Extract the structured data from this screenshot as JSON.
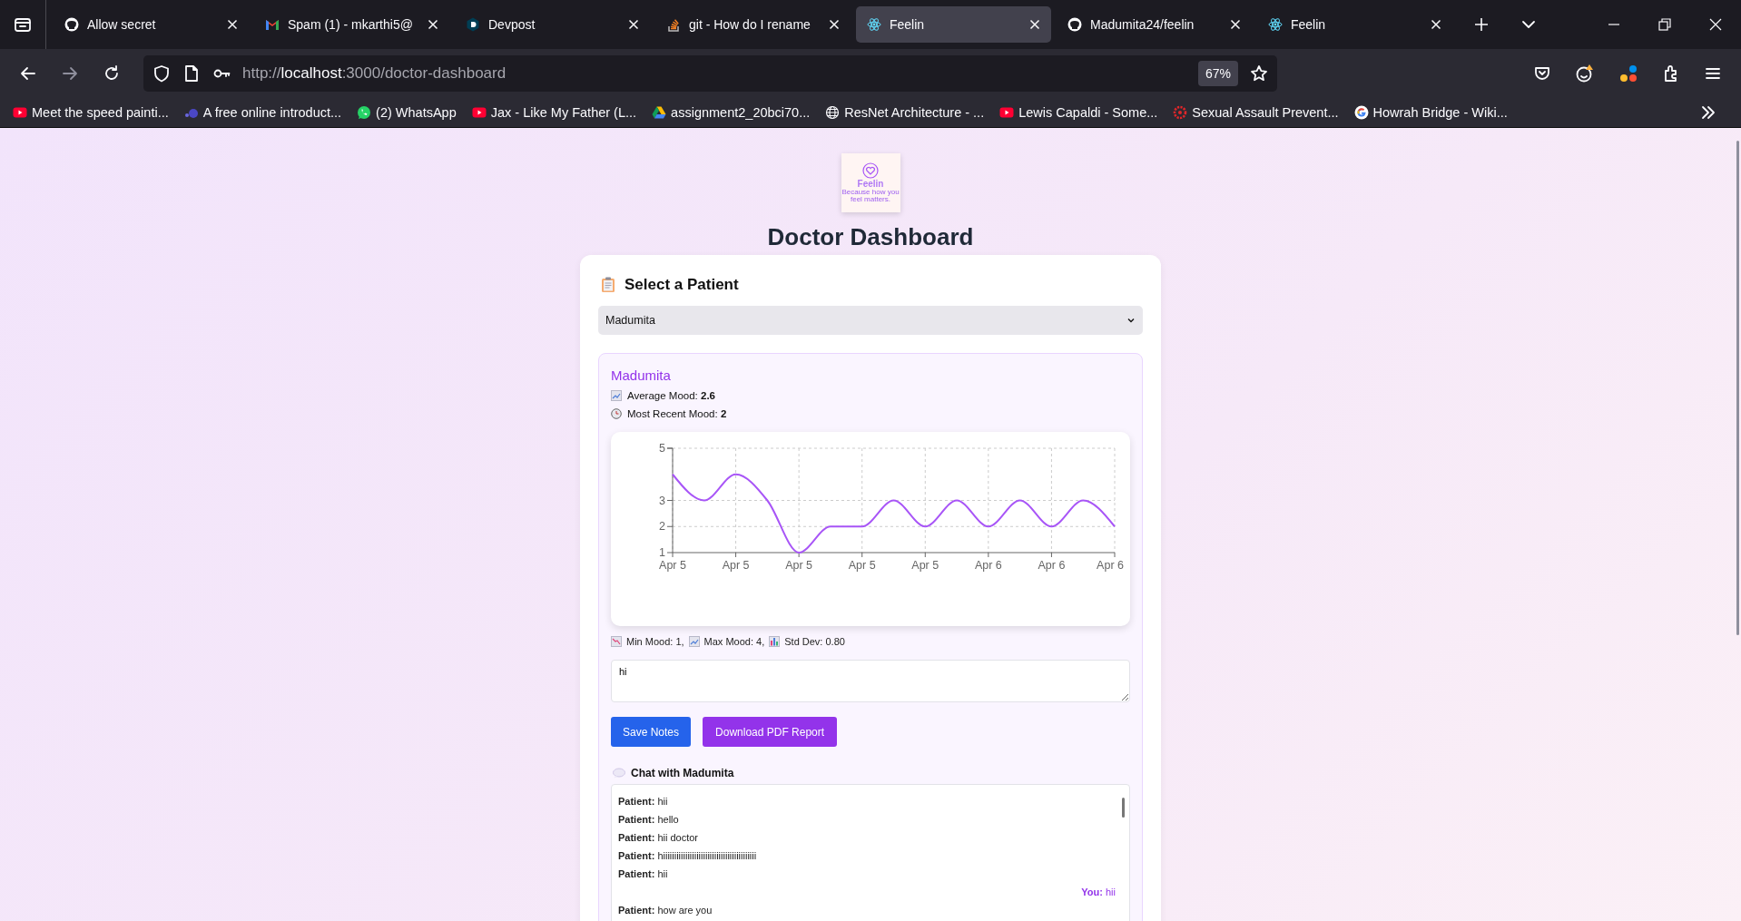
{
  "browser": {
    "tabs": [
      {
        "title": "Allow secret",
        "kind": "octo",
        "selected": false
      },
      {
        "title": "Spam (1) - mkarthi5@",
        "kind": "envelope",
        "selected": false
      },
      {
        "title": "Devpost",
        "kind": "hexagon",
        "selected": false
      },
      {
        "title": "git - How do I rename",
        "kind": "stack",
        "selected": false
      },
      {
        "title": "Feelin",
        "kind": "atom",
        "selected": true
      },
      {
        "title": "Madumita24/feelin",
        "kind": "octo",
        "selected": false
      },
      {
        "title": "Feelin",
        "kind": "atom",
        "selected": false
      }
    ],
    "url": {
      "scheme": "http://",
      "host": "localhost",
      "path": ":3000/doctor-dashboard"
    },
    "zoom": "67%",
    "bookmarks": [
      {
        "title": "Meet the speed painti...",
        "kind": "play"
      },
      {
        "title": "A free online introduct...",
        "kind": "dots"
      },
      {
        "title": "(2) WhatsApp",
        "kind": "bubble"
      },
      {
        "title": "Jax - Like My Father (L...",
        "kind": "play"
      },
      {
        "title": "assignment2_20bci70...",
        "kind": "triangle"
      },
      {
        "title": "ResNet Architecture - ...",
        "kind": "globe"
      },
      {
        "title": "Lewis Capaldi - Some...",
        "kind": "play"
      },
      {
        "title": "Sexual Assault Prevent...",
        "kind": "ring"
      },
      {
        "title": "Howrah Bridge - Wiki...",
        "kind": "multicolor"
      }
    ]
  },
  "page": {
    "logo": {
      "name": "Feelin",
      "tagline": "Because how you feel matters."
    },
    "title": "Doctor Dashboard",
    "select_heading": "Select a Patient",
    "patient_select": {
      "value": "Madumita"
    },
    "patient": {
      "name": "Madumita",
      "stats": [
        {
          "kind": "trend",
          "text": "Average Mood: **2.6**"
        },
        {
          "kind": "clock",
          "text": "Most Recent Mood: **2**"
        }
      ],
      "chart_data": {
        "type": "line",
        "categories": [
          "Apr 5",
          null,
          "Apr 5",
          null,
          "Apr 5",
          null,
          "Apr 5",
          null,
          "Apr 5",
          null,
          "Apr 6",
          null,
          "Apr 6",
          null,
          "Apr 6"
        ],
        "ylim": [
          1,
          5
        ],
        "yticks": [
          1,
          2,
          3,
          5
        ],
        "grid": true,
        "series": [
          {
            "color": "#a855f7",
            "values": [
              4,
              3,
              4,
              3,
              1,
              2,
              2,
              3,
              2,
              3,
              2,
              3,
              2,
              3,
              2
            ]
          }
        ]
      },
      "summary": [
        {
          "kind": "down",
          "text": "Min Mood: 1,"
        },
        {
          "kind": "up",
          "text": "Max Mood: 4,"
        },
        {
          "kind": "bars",
          "text": "Std Dev: 0.80"
        }
      ],
      "notes": {
        "value": "hi"
      },
      "buttons": [
        {
          "label": "Save Notes",
          "kind": "primary"
        },
        {
          "label": "Download PDF Report",
          "kind": "accent"
        }
      ],
      "chat_heading": "Chat with Madumita",
      "messages": [
        {
          "kind": "incoming",
          "text": "**Patient:** hii"
        },
        {
          "kind": "incoming",
          "text": "**Patient:** hello"
        },
        {
          "kind": "incoming",
          "text": "**Patient:** hii doctor"
        },
        {
          "kind": "incoming",
          "text": "**Patient:** hiiiiiiiiiiiiiiiiiiiiiiiiiiiiiiiiiiiiiiiiii"
        },
        {
          "kind": "incoming",
          "text": "**Patient:** hii"
        },
        {
          "kind": "outgoing",
          "text": "**You:** hii"
        },
        {
          "kind": "incoming",
          "text": "**Patient:** how are you"
        }
      ]
    }
  }
}
